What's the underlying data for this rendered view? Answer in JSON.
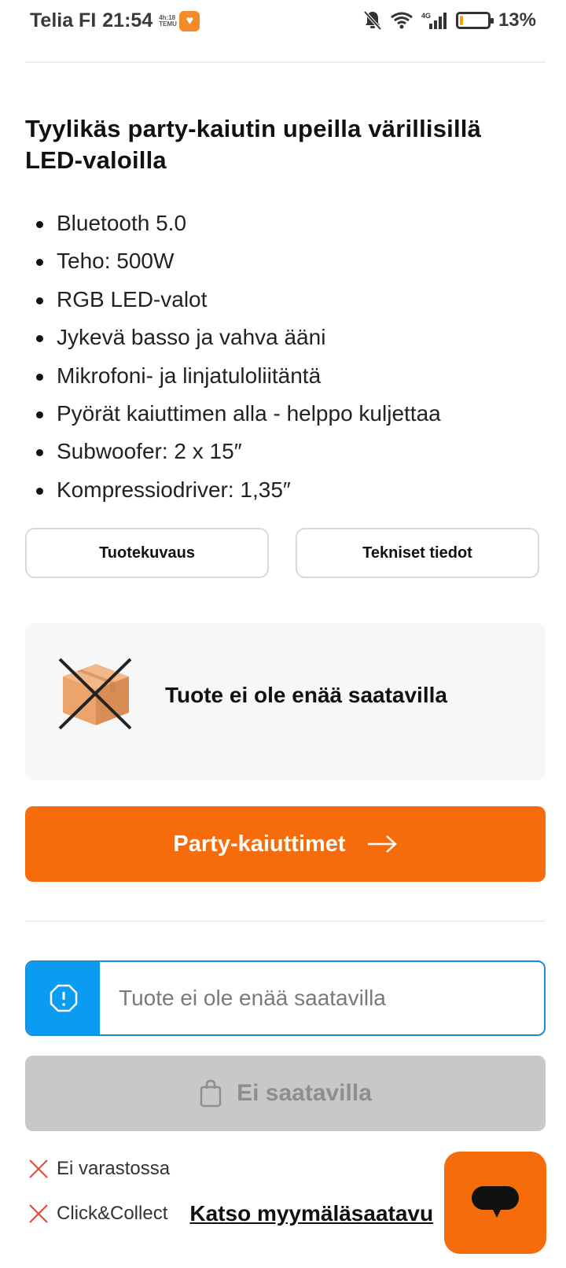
{
  "status_bar": {
    "carrier": "Telia FI",
    "time": "21:54",
    "mini_app_label": "4h:18 TEMU",
    "battery_percent": "13%",
    "battery_level": 0.13,
    "network": "4G"
  },
  "product": {
    "title": "Tyylikäs party-kaiutin upeilla värillisillä LED-valoilla",
    "features": [
      "Bluetooth 5.0",
      "Teho: 500W",
      "RGB LED-valot",
      "Jykevä basso ja vahva ääni",
      "Mikrofoni- ja linjatuloliitäntä",
      "Pyörät kaiuttimen alla - helppo kuljettaa",
      "Subwoofer: 2 x 15″",
      "Kompressiodriver: 1,35″"
    ]
  },
  "tabs": {
    "description_label": "Tuotekuvaus",
    "specs_label": "Tekniset tiedot"
  },
  "availability": {
    "card_text": "Tuote ei ole enää saatavilla",
    "category_button_label": "Party-kaiuttimet",
    "notice_text": "Tuote ei ole enää saatavilla",
    "buy_button_label": "Ei saatavilla",
    "stock_label": "Ei varastossa",
    "click_collect_label": "Click&Collect",
    "store_link_text": "Katso myymäläsaatavu"
  },
  "colors": {
    "accent_orange": "#f66c0a",
    "info_blue": "#0a9cf0",
    "disabled_gray": "#c8c8c8",
    "error_red": "#e5463a"
  }
}
